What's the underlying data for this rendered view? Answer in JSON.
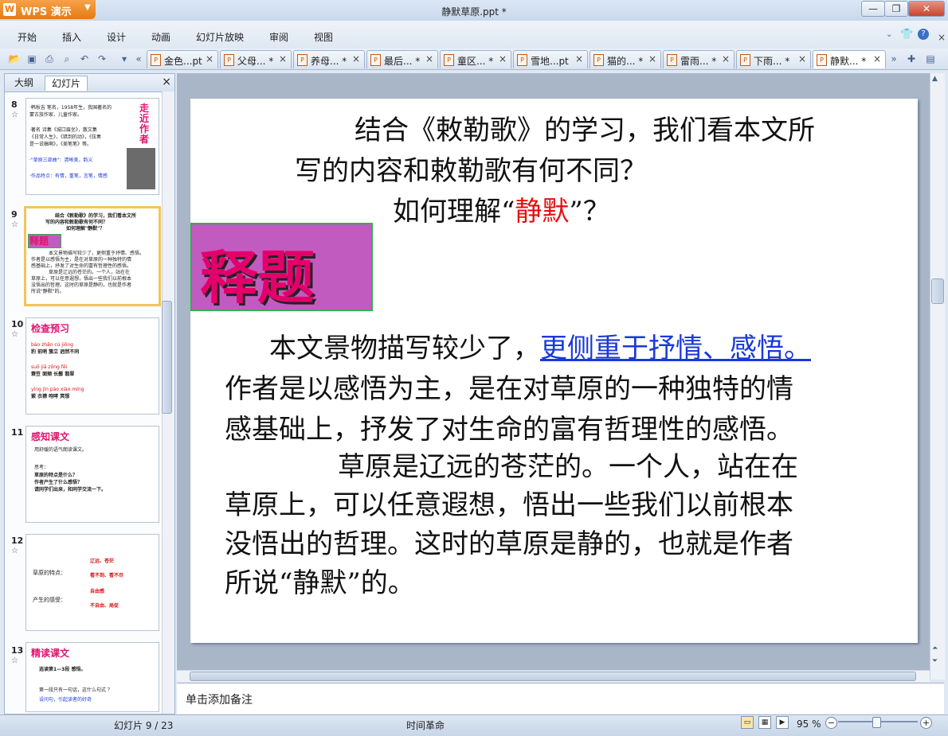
{
  "app": {
    "name": "WPS 演示",
    "window_title": "静默草原.ppt *"
  },
  "menu": [
    "开始",
    "插入",
    "设计",
    "动画",
    "幻灯片放映",
    "审阅",
    "视图"
  ],
  "tabs": [
    {
      "label": "金色...pt"
    },
    {
      "label": "父母... *"
    },
    {
      "label": "养母... *"
    },
    {
      "label": "最后... *"
    },
    {
      "label": "童区... *"
    },
    {
      "label": "雪地...pt"
    },
    {
      "label": "猫的... *"
    },
    {
      "label": "雷雨... *"
    },
    {
      "label": "下雨... *"
    },
    {
      "label": "静默... *"
    }
  ],
  "left_panel": {
    "tab_outline": "大纲",
    "tab_slides": "幻灯片",
    "slides": [
      {
        "num": "8",
        "title": "走近作者",
        "lines": [
          "·韩秋吉 笔名，1958年生，我国著名的",
          "蒙古族作家、儿童作家。",
          "·著名 诗集《城口眉坐》，散文集",
          "《日常人生》，《猎到的动》，《弦奏",
          "是一说稿啊》，《美笔笔》等。",
          "·\"草原三部曲\"：清晰美，韵义",
          "·作品特点：有情，重笔，言笔，情感"
        ]
      },
      {
        "num": "9",
        "title": "释题",
        "lines": [
          "结合《敕勒歌》的学习，我们看本文所",
          "写的内容和敕勒歌有何不同？",
          "如何理解\"静默\"？",
          "本文景物描写较少了，更侧重于抒情、感悟。",
          "作者是以感悟为主，是在对草原的一种独特的情",
          "感基础上，抒发了对生命的富有哲理性的感悟。",
          "草原是辽远的苍茫的。一个人，站在在",
          "草原上，可以任意遐想，悟出一些我们以前根本",
          "没悟出的哲理。这时的草原是静的，也就是作者",
          "所说\"静默\"的。"
        ]
      },
      {
        "num": "10",
        "title": "检查预习",
        "lines": [
          "bào    zhǎn    cù    jiōng",
          "豹    前哨    簇立    迥然不同",
          "suō    jiā    zōng    fēi",
          "蓑笠    面颊    长鬃    翡翠",
          "yíng    jìn    pào xiào    míng",
          "萦    衣襟    咆哮    冥想"
        ]
      },
      {
        "num": "11",
        "title": "感知课文",
        "lines": [
          "用舒缓的语气朗读课文。",
          "思考：",
          "草原的特点是什么？",
          "作者产生了什么感悟？",
          "请同学们出来，和同学交流一下。"
        ]
      },
      {
        "num": "12",
        "title": "",
        "lines": [
          "草原的特点：",
          "辽远、苍茫",
          "看不到、看不尽",
          "产生的感受：",
          "自由感",
          "不自由、局促"
        ]
      },
      {
        "num": "13",
        "title": "精读课文",
        "lines": [
          "选读第1—3段   感悟。",
          "第一段只有一句话，这什么句式 ？",
          "设问句，引起读者的好奇"
        ]
      }
    ]
  },
  "slide": {
    "q_line1": "结合《敕勒歌》的学习，我们看本文所",
    "q_line2": "写的内容和敕勒歌有何不同？",
    "q_line3_pre": "如何理解“",
    "q_line3_red": "静默",
    "q_line3_post": "”？",
    "section_title": "释题",
    "p1_pre": "本文景物描写较少了，",
    "p1_link": "更侧重于抒情、感悟。",
    "p1_l2": "作者是以感悟为主，是在对草原的一种独特的情",
    "p1_l3": "感基础上，抒发了对生命的富有哲理性的感悟。",
    "p2_l1": "草原是辽远的苍茫的。一个人，站在在",
    "p2_l2": "草原上，可以任意遐想，悟出一些我们以前根本",
    "p2_l3": "没悟出的哲理。这时的草原是静的，也就是作者",
    "p2_l4": "所说“静默”的。"
  },
  "notes_placeholder": "单击添加备注",
  "status": {
    "slide_counter": "幻灯片 9 / 23",
    "theme": "时间革命",
    "zoom": "95 %"
  }
}
